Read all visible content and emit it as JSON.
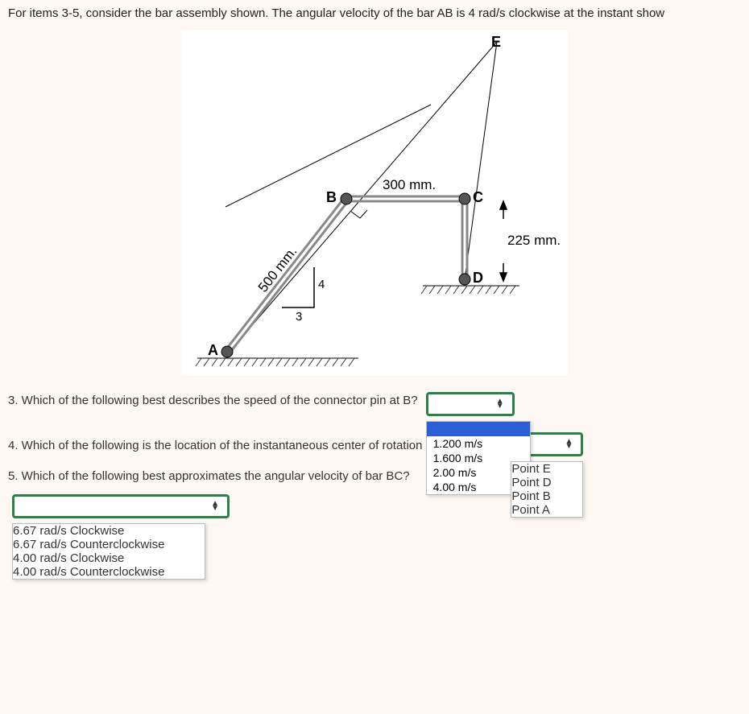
{
  "intro": "For items 3-5, consider the bar assembly shown. The angular velocity of the bar AB is 4 rad/s clockwise at the instant show",
  "diagram": {
    "labels": {
      "A": "A",
      "B": "B",
      "C": "C",
      "D": "D",
      "E": "E",
      "dim_ab": "500 mm.",
      "dim_bc": "300 mm.",
      "dim_cd": "225 mm.",
      "slope_run": "3",
      "slope_rise": "4"
    }
  },
  "q3": {
    "text": "3. Which of the following best describes the speed of the connector pin at B?",
    "options": [
      "1.200 m/s",
      "1.600 m/s",
      "2.00 m/s",
      "4.00 m/s"
    ]
  },
  "q4": {
    "text": "4. Which of the following is the location of the instantaneous center of rotation of bar BC?",
    "options": [
      "Point E",
      "Point D",
      "Point B",
      "Point A"
    ]
  },
  "q5": {
    "text": "5. Which of the following best approximates the angular velocity of bar BC?",
    "options": [
      "6.67 rad/s Clockwise",
      "6.67 rad/s Counterclockwise",
      "4.00 rad/s Clockwise",
      "4.00 rad/s Counterclockwise"
    ]
  }
}
